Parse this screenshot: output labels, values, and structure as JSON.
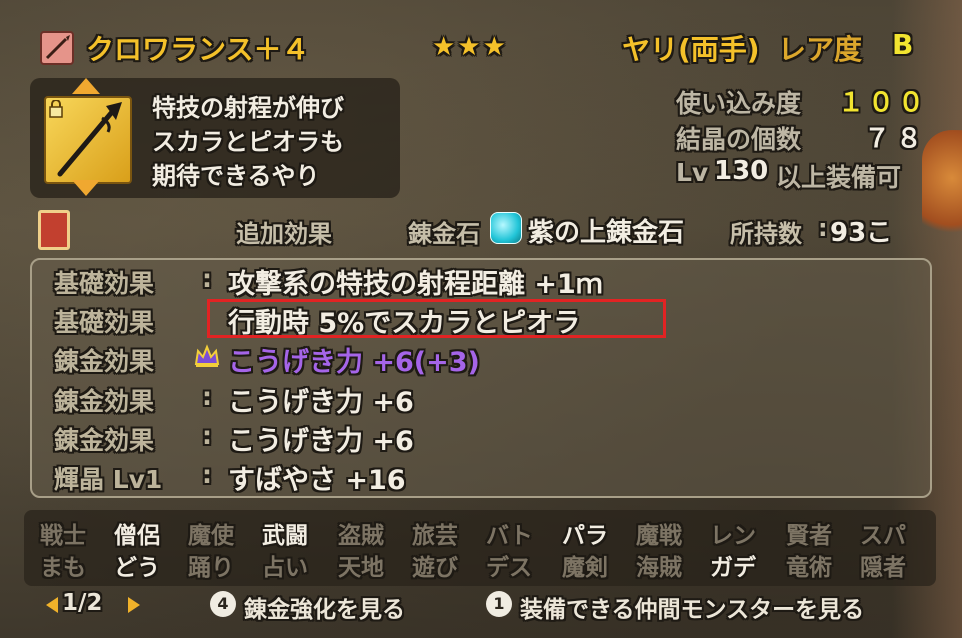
{
  "header": {
    "item_name": "クロワランス＋４",
    "stars": "★★★",
    "weapon_type": "ヤリ(両手)",
    "rarity_label": "レア度",
    "rarity_value": "B"
  },
  "description": {
    "lines": [
      "特技の射程が伸び",
      "スカラとピオラも",
      "期待できるやり"
    ]
  },
  "stats": {
    "usage_label": "使い込み度",
    "usage_value": "１００",
    "crystal_label": "結晶の個数",
    "crystal_value": "７８",
    "level_prefix": "Lv",
    "level_value": "130",
    "level_suffix": "以上装備可"
  },
  "alchemy_row": {
    "section_label": "追加効果",
    "stone_label": "錬金石",
    "stone_name": "紫の上錬金石",
    "owned_label": "所持数",
    "owned_colon": ":",
    "owned_value": "93こ"
  },
  "effects": [
    {
      "label": "基礎効果",
      "colon": ":",
      "text": "攻撃系の特技の射程距離 +1ｍ"
    },
    {
      "label": "基礎効果",
      "colon": "",
      "text": "行動時 5%でスカラとピオラ"
    },
    {
      "label": "錬金効果",
      "colon": "",
      "text": "こうげき力 +6(+3)"
    },
    {
      "label": "錬金効果",
      "colon": ":",
      "text": "こうげき力 +6"
    },
    {
      "label": "錬金効果",
      "colon": ":",
      "text": "こうげき力 +6"
    },
    {
      "label": "輝晶 Lv1",
      "colon": ":",
      "text": "すばやさ +16"
    }
  ],
  "jobs": {
    "top": [
      "戦士",
      "僧侶",
      "魔使",
      "武闘",
      "盗賊",
      "旅芸",
      "バト",
      "パラ",
      "魔戦",
      "レン",
      "賢者",
      "スパ"
    ],
    "bottom": [
      "まも",
      "どう",
      "踊り",
      "占い",
      "天地",
      "遊び",
      "デス",
      "魔剣",
      "海賊",
      "ガデ",
      "竜術",
      "隠者"
    ],
    "top_equippable": [
      false,
      true,
      false,
      true,
      false,
      false,
      false,
      true,
      false,
      false,
      false,
      false
    ],
    "bottom_equippable": [
      false,
      true,
      false,
      false,
      false,
      false,
      false,
      false,
      false,
      true,
      false,
      false
    ]
  },
  "footer": {
    "page": "1/2",
    "button4_glyph": "4",
    "button4_label": "錬金強化を見る",
    "button1_glyph": "1",
    "button1_label": "装備できる仲間モンスターを見る"
  },
  "colors": {
    "highlight_box": "#e22323",
    "title_gold": "#f4c12a",
    "value_yellow": "#f2e430",
    "alchemy_purple": "#a565e8"
  },
  "icons": {
    "weapon_category": "spear-icon",
    "item": "spear-item-icon",
    "lock": "lock-icon",
    "book": "book-icon",
    "stone": "alchemy-stone-icon",
    "crown": "crown-icon"
  }
}
